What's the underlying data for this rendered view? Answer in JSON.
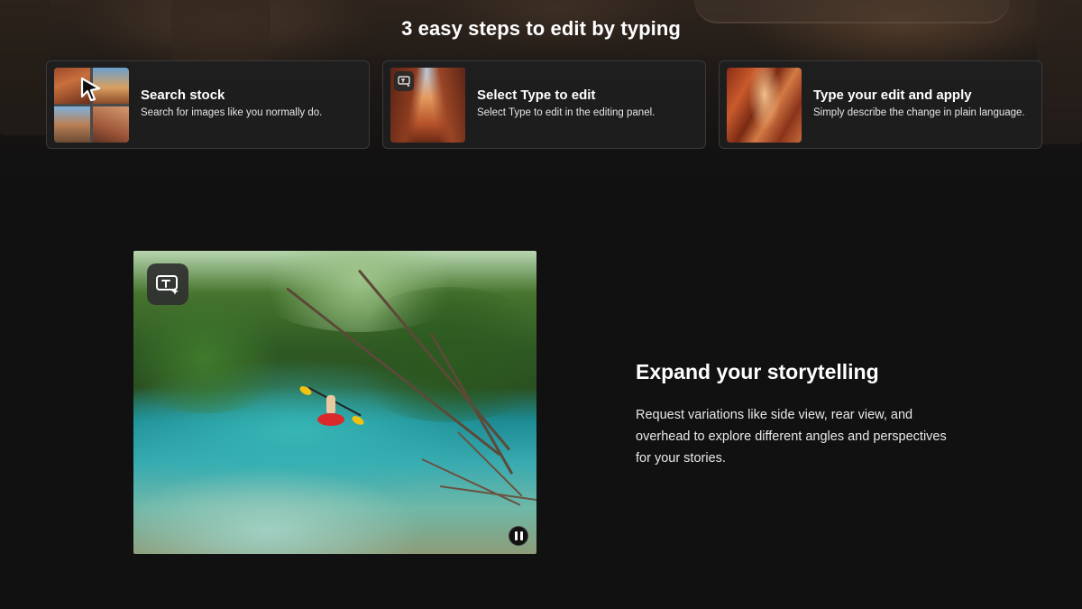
{
  "section": {
    "title": "3 easy steps to edit by typing"
  },
  "steps": [
    {
      "title": "Search stock",
      "description": "Search for images like you normally do.",
      "thumb_icon": "arrow-cursor-icon"
    },
    {
      "title": "Select Type to edit",
      "description": "Select Type to edit in the editing panel.",
      "thumb_icon": "type-edit-icon"
    },
    {
      "title": "Type your edit and apply",
      "description": "Simply describe the change in plain language.",
      "thumb_icon": ""
    }
  ],
  "feature": {
    "title": "Expand your storytelling",
    "body": "Request variations like side view, rear view, and overhead to explore different angles and perspectives for your stories.",
    "media_badge_icon": "type-edit-icon",
    "media_control_icon": "pause-icon"
  },
  "colors": {
    "background": "#111111",
    "card_background": "#1e1e1f",
    "card_border": "#3a3a3a",
    "text_primary": "#ffffff"
  }
}
